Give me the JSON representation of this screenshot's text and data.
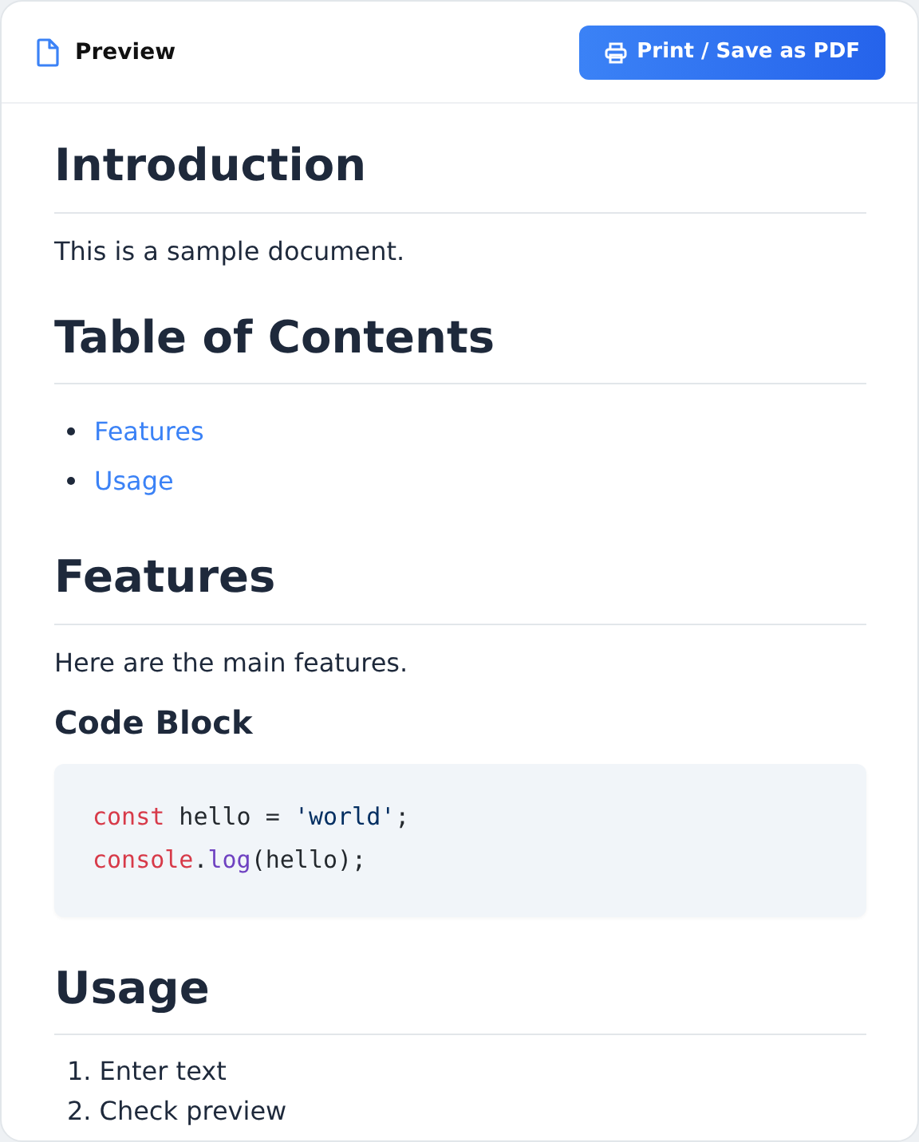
{
  "header": {
    "title": "Preview",
    "button": "Print / Save as PDF"
  },
  "blocks": [
    {
      "kind": "h2",
      "text": "Introduction"
    },
    {
      "kind": "p",
      "text": "This is a sample document."
    },
    {
      "kind": "h2",
      "text": "Table of Contents"
    },
    {
      "kind": "ul",
      "items": [
        "Features",
        "Usage"
      ]
    },
    {
      "kind": "h2",
      "text": "Features"
    },
    {
      "kind": "p",
      "text": "Here are the main features."
    },
    {
      "kind": "h3",
      "text": "Code Block"
    },
    {
      "kind": "code",
      "lines": [
        [
          {
            "kind": "keyword",
            "text": "const"
          },
          {
            "kind": "plain",
            "text": " hello = "
          },
          {
            "kind": "string",
            "text": "'world'"
          },
          {
            "kind": "plain",
            "text": ";"
          }
        ],
        [
          {
            "kind": "keyword",
            "text": "console"
          },
          {
            "kind": "plain",
            "text": "."
          },
          {
            "kind": "function",
            "text": "log"
          },
          {
            "kind": "plain",
            "text": "(hello);"
          }
        ]
      ]
    },
    {
      "kind": "h2",
      "text": "Usage"
    },
    {
      "kind": "ol",
      "items": [
        {
          "marker": "1.",
          "text": "Enter text"
        },
        {
          "marker": "2.",
          "text": "Check preview"
        }
      ]
    }
  ]
}
